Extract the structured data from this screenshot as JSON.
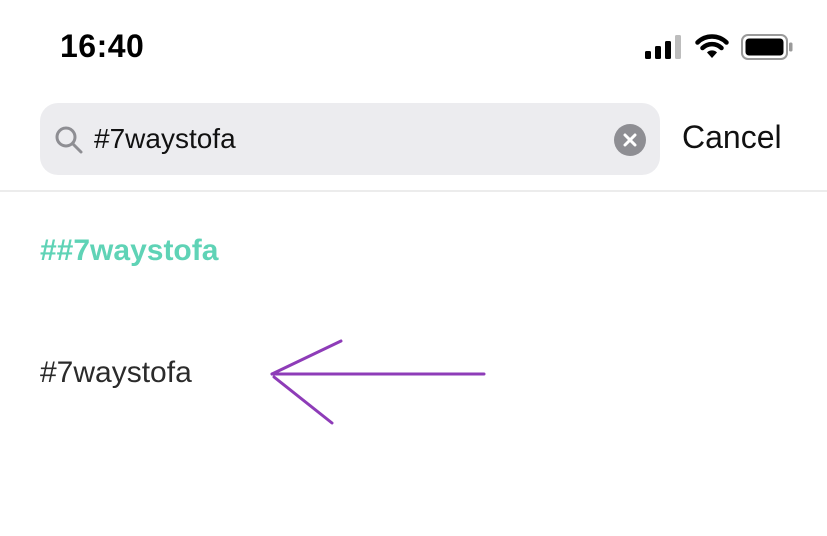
{
  "status_bar": {
    "time": "16:40",
    "icons": [
      "cellular-signal-icon",
      "wifi-icon",
      "battery-icon"
    ]
  },
  "search": {
    "value": "#7waystofa",
    "icon": "search-icon",
    "clear_icon": "clear-icon",
    "cancel_label": "Cancel"
  },
  "results": {
    "hashtag_suggestion": "##7waystofa",
    "items": [
      {
        "label": "#7waystofa"
      }
    ]
  },
  "annotation": {
    "type": "hand-drawn arrow",
    "color": "#8e3cb8"
  },
  "colors": {
    "accent": "#5fd3b6",
    "search_bg": "#ececef",
    "clear_button": "#8e8e93"
  }
}
